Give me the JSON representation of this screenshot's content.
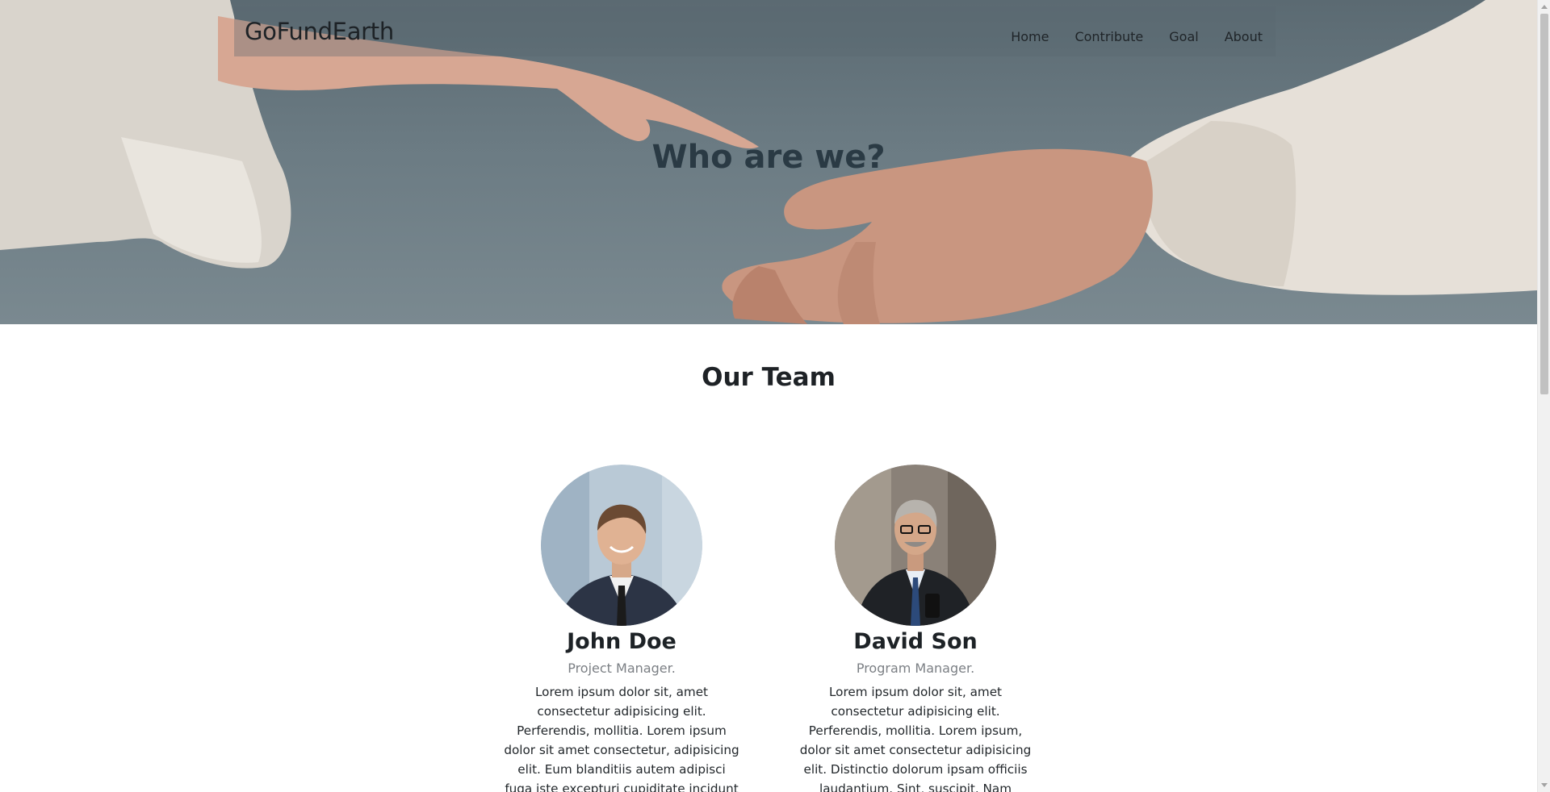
{
  "navbar": {
    "brand": "GoFundEarth",
    "links": [
      "Home",
      "Contribute",
      "Goal",
      "About"
    ]
  },
  "hero": {
    "title": "Who are we?"
  },
  "team": {
    "title": "Our Team",
    "members": [
      {
        "name": "John Doe",
        "role": "Project Manager.",
        "bio": "Lorem ipsum dolor sit, amet consectetur adipisicing elit. Perferendis, mollitia. Lorem ipsum dolor sit amet consectetur, adipisicing elit. Eum blanditiis autem adipisci fuga iste excepturi cupiditate incidunt perferendis saepe? Dolor"
      },
      {
        "name": "David Son",
        "role": "Program Manager.",
        "bio": "Lorem ipsum dolor sit, amet consectetur adipisicing elit. Perferendis, mollitia. Lorem ipsum, dolor sit amet consectetur adipisicing elit. Distinctio dolorum ipsam officiis laudantium. Sint, suscipit. Nam mollitia itaque quibusdam error"
      }
    ]
  },
  "colors": {
    "hero_bg": "#6b7b83",
    "text_dark": "#212529",
    "text_muted": "#7b7f84"
  }
}
